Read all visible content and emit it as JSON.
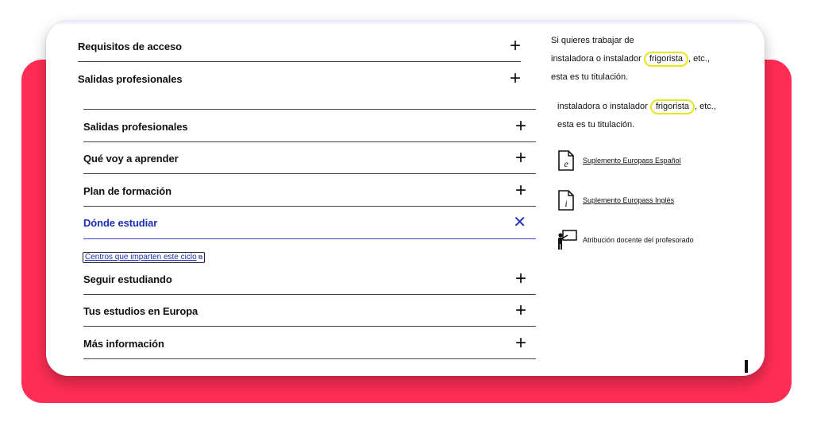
{
  "accordion_top": [
    {
      "label": "Requisitos de acceso",
      "icon": "plus-icon"
    },
    {
      "label": "Salidas profesionales",
      "icon": "plus-icon"
    }
  ],
  "accordion_main": [
    {
      "label": "Salidas profesionales",
      "state": "collapsed"
    },
    {
      "label": "Qué voy a aprender",
      "state": "collapsed"
    },
    {
      "label": "Plan de formación",
      "state": "collapsed"
    },
    {
      "label": "Dónde estudiar",
      "state": "expanded"
    },
    {
      "label": "Seguir estudiando",
      "state": "collapsed"
    },
    {
      "label": "Tus estudios en Europa",
      "state": "collapsed"
    },
    {
      "label": "Más información",
      "state": "collapsed"
    }
  ],
  "centros_link": "Centros que imparten este ciclo",
  "side_top": {
    "line1": "Si quieres trabajar de",
    "line2_pre": "instaladora o instalador",
    "line2_hl": "frigorista",
    "line2_post": ", etc.,",
    "line3": "esta es tu titulación."
  },
  "side_dup": {
    "line1_pre": "instaladora o instalador",
    "line1_hl": "frigorista",
    "line1_post": ", etc.,",
    "line2": "esta es tu titulación."
  },
  "resources": [
    {
      "label": "Suplemento Europass Español",
      "icon": "document-e-icon",
      "link": true
    },
    {
      "label": "Suplemento Europass Inglés",
      "icon": "document-i-icon",
      "link": true
    },
    {
      "label": "Atribución docente del profesorado",
      "icon": "teacher-board-icon",
      "link": false
    }
  ],
  "colors": {
    "accent_blue": "#1a2fb3",
    "brand_red": "#ff2d55",
    "highlight_yellow": "#e8e61a"
  }
}
